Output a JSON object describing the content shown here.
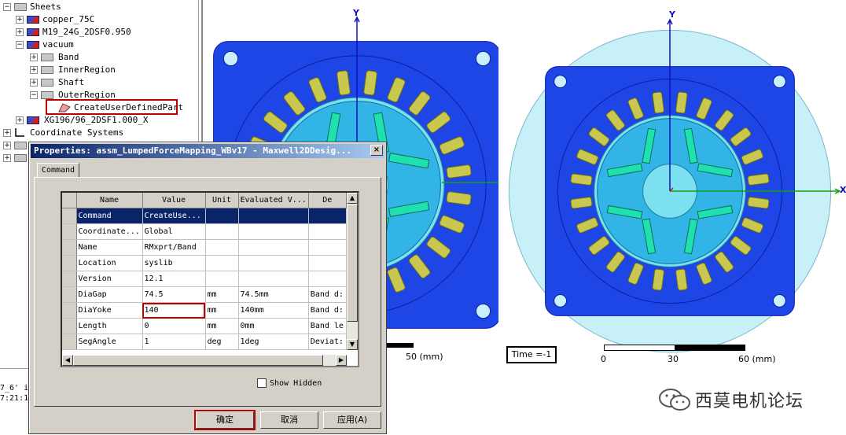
{
  "tree": {
    "items": [
      {
        "label": "Sheets",
        "expander": "−",
        "icon": "sheet-icon"
      },
      {
        "label": "copper_75C",
        "expander": "+",
        "icon": "material-icon"
      },
      {
        "label": "M19_24G_2DSF0.950",
        "expander": "+",
        "icon": "material-icon"
      },
      {
        "label": "vacuum",
        "expander": "−",
        "icon": "material-icon"
      },
      {
        "label": "Band",
        "expander": "+",
        "icon": "sheet-icon"
      },
      {
        "label": "InnerRegion",
        "expander": "+",
        "icon": "sheet-icon"
      },
      {
        "label": "Shaft",
        "expander": "+",
        "icon": "sheet-icon"
      },
      {
        "label": "OuterRegion",
        "expander": "−",
        "icon": "sheet-icon"
      },
      {
        "label": "CreateUserDefinedPart",
        "expander": "",
        "icon": "part-icon"
      },
      {
        "label": "XG196/96_2DSF1.000_X",
        "expander": "+",
        "icon": "material-icon"
      },
      {
        "label": "Coordinate Systems",
        "expander": "+",
        "icon": "axis-icon"
      }
    ]
  },
  "console": {
    "line1": "7_6' i",
    "line2": "7:21:1"
  },
  "dialog": {
    "title": "Properties: assm_LumpedForceMapping_WBv17 - Maxwell2DDesig...",
    "close": "×",
    "tab": "Command",
    "columns": [
      "Name",
      "Value",
      "Unit",
      "Evaluated V...",
      "De"
    ],
    "rows": [
      {
        "name": "Command",
        "value": "CreateUse...",
        "unit": "",
        "evaluated": "",
        "desc": ""
      },
      {
        "name": "Coordinate...",
        "value": "Global",
        "unit": "",
        "evaluated": "",
        "desc": ""
      },
      {
        "name": "Name",
        "value": "RMxprt/Band",
        "unit": "",
        "evaluated": "",
        "desc": ""
      },
      {
        "name": "Location",
        "value": "syslib",
        "unit": "",
        "evaluated": "",
        "desc": ""
      },
      {
        "name": "Version",
        "value": "12.1",
        "unit": "",
        "evaluated": "",
        "desc": ""
      },
      {
        "name": "DiaGap",
        "value": "74.5",
        "unit": "mm",
        "evaluated": "74.5mm",
        "desc": "Band d:"
      },
      {
        "name": "DiaYoke",
        "value": "140",
        "unit": "mm",
        "evaluated": "140mm",
        "desc": "Band d:"
      },
      {
        "name": "Length",
        "value": "0",
        "unit": "mm",
        "evaluated": "0mm",
        "desc": "Band le"
      },
      {
        "name": "SegAngle",
        "value": "1",
        "unit": "deg",
        "evaluated": "1deg",
        "desc": "Deviat:"
      }
    ],
    "show_hidden": "Show Hidden",
    "ok": "确定",
    "cancel": "取消",
    "apply": "应用(A)"
  },
  "viewport_left": {
    "y_axis": "Y",
    "scale_end": "50 (mm)"
  },
  "viewport_right": {
    "y_axis": "Y",
    "x_axis": "X",
    "time": "Time =-1",
    "scale": [
      "0",
      "30",
      "60 (mm)"
    ]
  },
  "watermark": {
    "text": "西莫电机论坛"
  },
  "colors": {
    "stator": "#1e46e6",
    "rotor": "#33b4e6",
    "airgap": "#7de0f0",
    "coil": "#c8c850",
    "magnet": "#20e0b0",
    "title_bar": "#0a246a",
    "highlight": "#c00000"
  }
}
